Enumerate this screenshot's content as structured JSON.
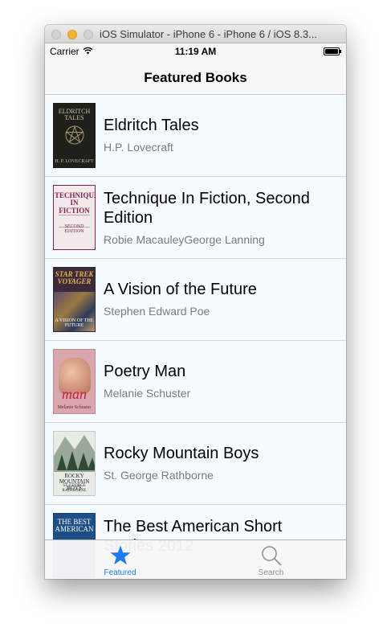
{
  "window": {
    "title": "iOS Simulator - iPhone 6 - iPhone 6 / iOS 8.3..."
  },
  "status_bar": {
    "carrier": "Carrier",
    "time": "11:19 AM",
    "battery_level": 1.0
  },
  "nav_bar": {
    "title": "Featured Books"
  },
  "books": [
    {
      "title": "Eldritch Tales",
      "author": "H.P. Lovecraft",
      "cover": {
        "text": "ELDRITCH TALES",
        "sub": "H. P. LOVECRAFT",
        "bg": "#1f1f1c",
        "fg": "#c9c2a0"
      }
    },
    {
      "title": "Technique In Fiction, Second Edition",
      "author": "Robie MacauleyGeorge Lanning",
      "cover": {
        "text": "TECHNIQUE IN FICTION",
        "sub": "SECOND EDITION",
        "bg": "#f1e9ea",
        "fg": "#8a1f4d"
      }
    },
    {
      "title": "A Vision of the Future",
      "author": "Stephen Edward Poe",
      "cover": {
        "text": "STAR TREK VOYAGER",
        "sub": "A VISION OF THE FUTURE",
        "bg": "#3b2a3e",
        "fg": "#e6b341"
      }
    },
    {
      "title": "Poetry Man",
      "author": "Melanie Schuster",
      "cover": {
        "text": "Melanie Schuster",
        "sub": "man",
        "bg": "#d9a7ad",
        "fg": "#6a2030"
      }
    },
    {
      "title": "Rocky Mountain Boys",
      "author": "St. George Rathborne",
      "cover": {
        "text": "ROCKY MOUNTAIN BOYS",
        "sub": "ST. GEORGE RATHBORNE",
        "bg": "#e9ece6",
        "fg": "#1d2a22"
      }
    },
    {
      "title": "The Best American Short Stories 2012",
      "author": "",
      "cover": {
        "text": "THE BEST AMERICAN",
        "sub": "",
        "bg": "#1d4f86",
        "fg": "#ffffff"
      }
    }
  ],
  "tab_bar": {
    "items": [
      {
        "label": "Featured",
        "icon": "star-icon",
        "selected": true
      },
      {
        "label": "Search",
        "icon": "magnifier-icon",
        "selected": false
      }
    ],
    "selected_color": "#1a7cf5",
    "unselected_color": "#929292"
  }
}
